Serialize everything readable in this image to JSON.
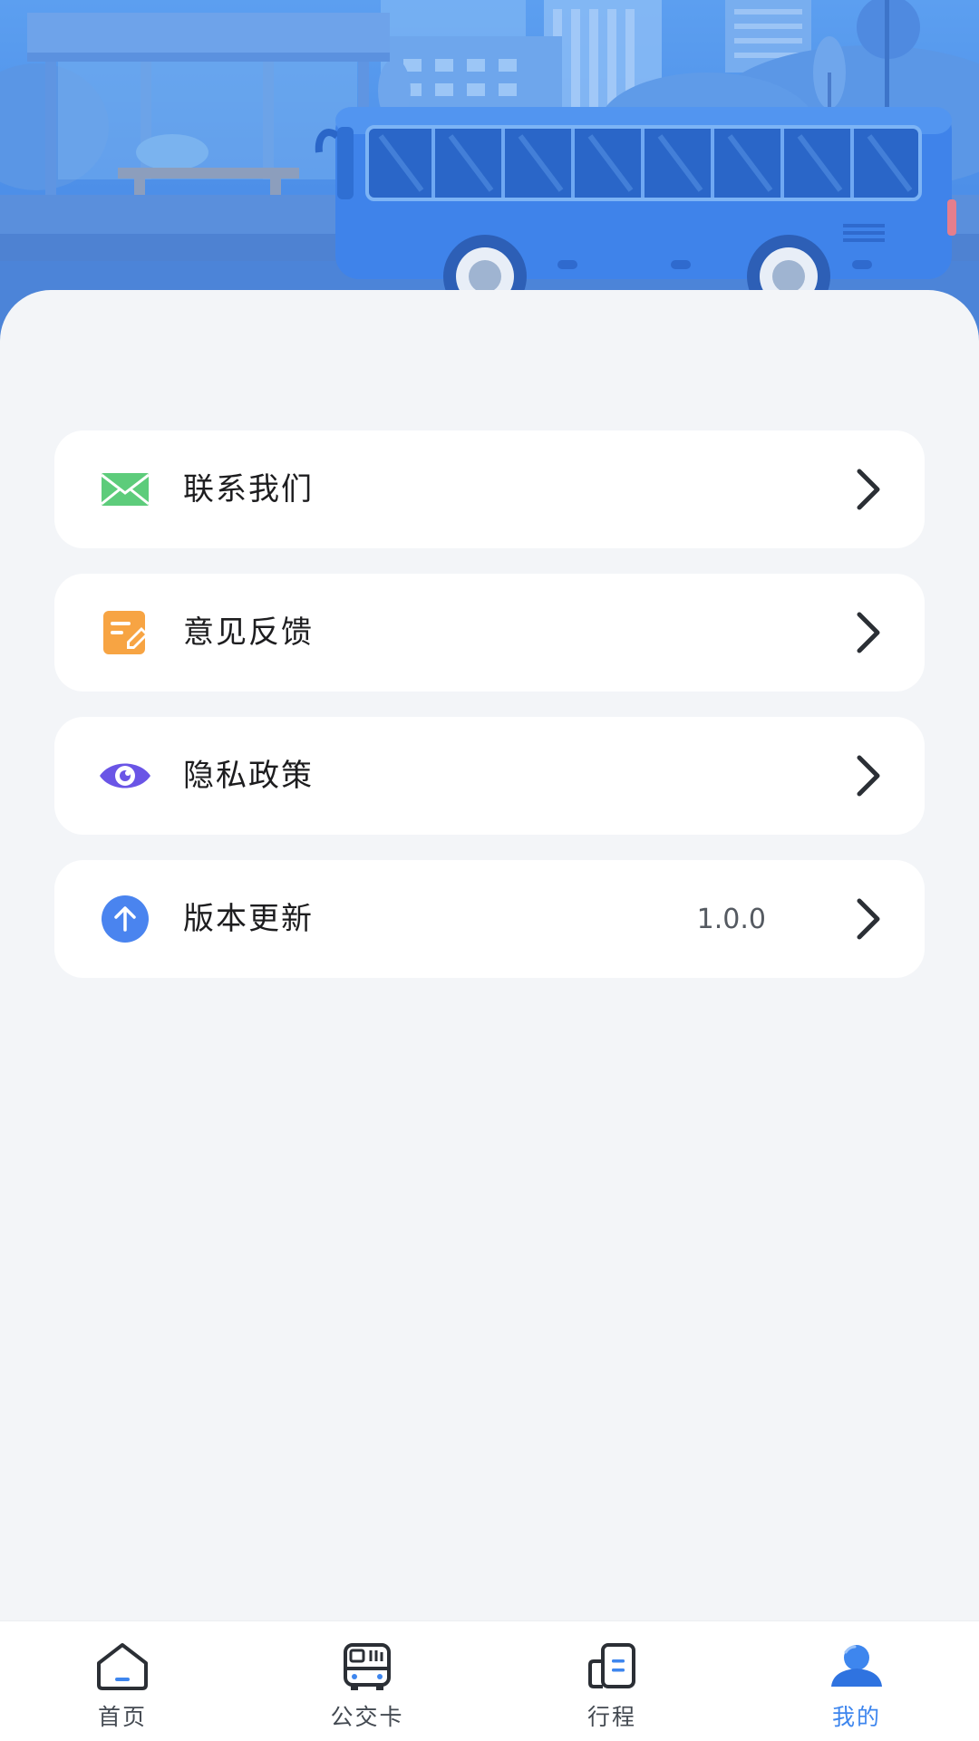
{
  "menu": {
    "items": [
      {
        "label": "联系我们",
        "icon": "mail-icon",
        "icon_color": "#5dcc7b"
      },
      {
        "label": "意见反馈",
        "icon": "feedback-edit-icon",
        "icon_color": "#f7a443"
      },
      {
        "label": "隐私政策",
        "icon": "eye-icon",
        "icon_color": "#6a55e6"
      },
      {
        "label": "版本更新",
        "icon": "upload-arrow-icon",
        "icon_color": "#4a84ef",
        "value": "1.0.0"
      }
    ]
  },
  "tabbar": {
    "active_color": "#3e86ee",
    "items": [
      {
        "label": "首页",
        "icon": "home-icon"
      },
      {
        "label": "公交卡",
        "icon": "bus-card-icon"
      },
      {
        "label": "行程",
        "icon": "trip-icon"
      },
      {
        "label": "我的",
        "icon": "user-icon",
        "active": true
      }
    ]
  }
}
